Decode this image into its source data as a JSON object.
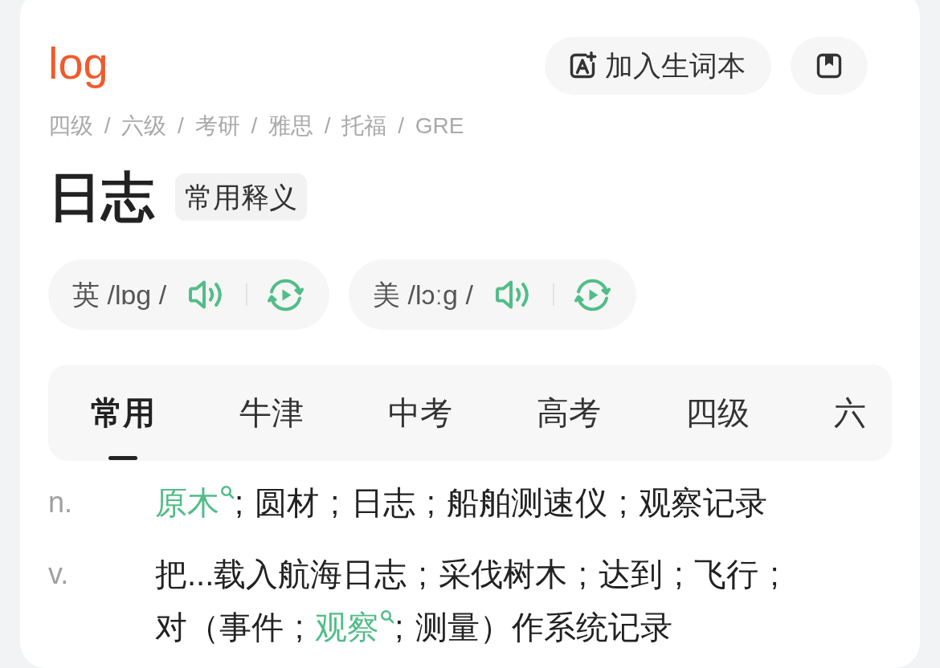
{
  "header": {
    "headword": "log",
    "add_button": {
      "label": "加入生词本"
    },
    "exam_tags": "四级 / 六级 / 考研 / 雅思 / 托福 / GRE"
  },
  "meaning": {
    "title": "日志",
    "badge": "常用释义"
  },
  "pronunciations": [
    {
      "label": "英 /lɒg /"
    },
    {
      "label": "美 /lɔːg /"
    }
  ],
  "tabs": [
    {
      "label": "常用",
      "selected": true
    },
    {
      "label": "牛津",
      "selected": false
    },
    {
      "label": "中考",
      "selected": false
    },
    {
      "label": "高考",
      "selected": false
    },
    {
      "label": "四级",
      "selected": false
    },
    {
      "label": "六",
      "selected": false
    }
  ],
  "definitions": [
    {
      "pos": "n.",
      "segments": [
        {
          "kind": "link",
          "text": "原木"
        },
        {
          "kind": "plain",
          "text": "; 圆材 ; 日志 ; 船舶测速仪 ; 观察记录"
        }
      ]
    },
    {
      "pos": "v.",
      "segments": [
        {
          "kind": "plain",
          "text": "把...载入航海日志 ; 采伐树木 ; 达到 ; 飞行 ; 对（事件 ; "
        },
        {
          "kind": "link",
          "text": "观察"
        },
        {
          "kind": "plain",
          "text": "; 测量）作系统记录"
        }
      ]
    }
  ]
}
